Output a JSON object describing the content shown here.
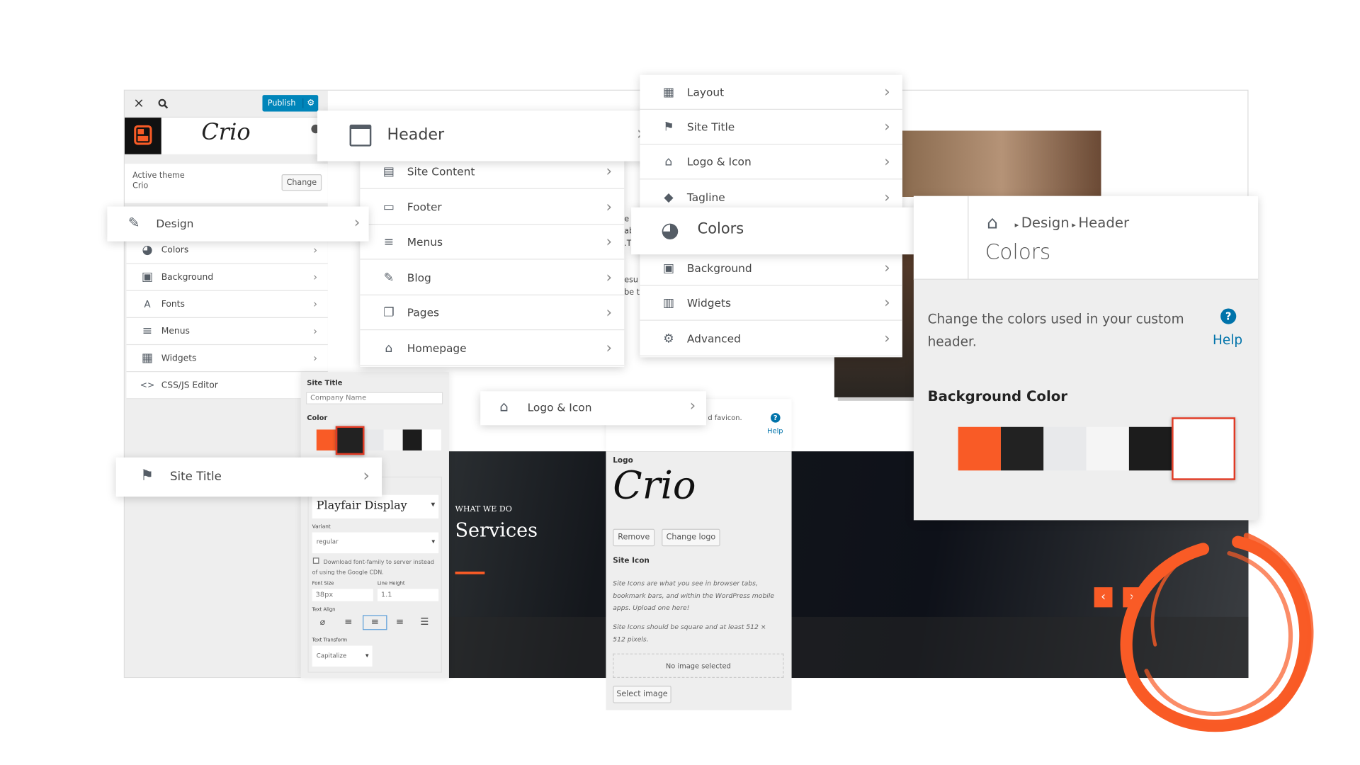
{
  "toolbar": {
    "close": "×",
    "publish": "Publish"
  },
  "theme": {
    "active_label": "Active theme",
    "name": "Crio",
    "change": "Change",
    "logo_text": "Crio"
  },
  "sidebar": {
    "items": [
      {
        "label": "Colors",
        "icon": "palette-icon"
      },
      {
        "label": "Background",
        "icon": "image-icon"
      },
      {
        "label": "Fonts",
        "icon": "font-icon"
      },
      {
        "label": "Menus",
        "icon": "menu-icon"
      },
      {
        "label": "Widgets",
        "icon": "widgets-icon"
      },
      {
        "label": "CSS/JS Editor",
        "icon": "code-icon"
      }
    ]
  },
  "design_bar": {
    "label": "Design"
  },
  "header_bar": {
    "label": "Header"
  },
  "site_menu": {
    "items": [
      {
        "label": "Site Content"
      },
      {
        "label": "Footer"
      },
      {
        "label": "Menus"
      },
      {
        "label": "Blog"
      },
      {
        "label": "Pages"
      },
      {
        "label": "Homepage"
      }
    ]
  },
  "header_menu": {
    "items": [
      {
        "label": "Layout"
      },
      {
        "label": "Site Title"
      },
      {
        "label": "Logo & Icon"
      },
      {
        "label": "Tagline"
      },
      {
        "label": "Background"
      },
      {
        "label": "Widgets"
      },
      {
        "label": "Advanced"
      }
    ]
  },
  "colors_bar": {
    "label": "Colors"
  },
  "colors_panel": {
    "breadcrumb": [
      "Design",
      "Header"
    ],
    "title": "Colors",
    "description": "Change the colors used in your custom header.",
    "help": "Help",
    "section": "Background Color",
    "swatches": [
      "#f95b26",
      "#222222",
      "#e8e9eb",
      "#f5f5f5",
      "#1c1c1c",
      "#ffffff"
    ],
    "selected_index": 5
  },
  "site_title_panel": {
    "label": "Site Title",
    "input_value": "Company Name",
    "color_label": "Color",
    "swatches": [
      "#f95b26",
      "#222222",
      "#e8e9eb",
      "#f5f5f5",
      "#1c1c1c",
      "#ffffff"
    ],
    "selected_index": 1
  },
  "site_title_bar": {
    "label": "Site Title"
  },
  "font_panel": {
    "font": "Playfair Display",
    "variant_label": "Variant",
    "variant": "regular",
    "download_label": "Download font-family to server instead of using the Google CDN.",
    "font_size_label": "Font Size",
    "font_size": "38px",
    "line_height_label": "Line Height",
    "line_height": "1.1",
    "text_align_label": "Text Align",
    "text_transform_label": "Text Transform",
    "text_transform": "Capitalize"
  },
  "hero": {
    "kicker": "WHAT WE DO",
    "title": "Services"
  },
  "logo_bar": {
    "label": "Logo & Icon"
  },
  "logo_panel": {
    "intro_tail": "d favicon.",
    "help": "Help",
    "logo_label": "Logo",
    "remove": "Remove",
    "change_logo": "Change logo",
    "site_icon_label": "Site Icon",
    "desc1": "Site Icons are what you see in browser tabs, bookmark bars, and within the WordPress mobile apps. Upload one here!",
    "desc2": "Site Icons should be square and at least 512 × 512 pixels.",
    "no_image": "No image selected",
    "select_image": "Select image"
  },
  "colors": {
    "accent": "#f95b26",
    "publish_blue": "#0085ba",
    "help_blue": "#0073aa"
  }
}
